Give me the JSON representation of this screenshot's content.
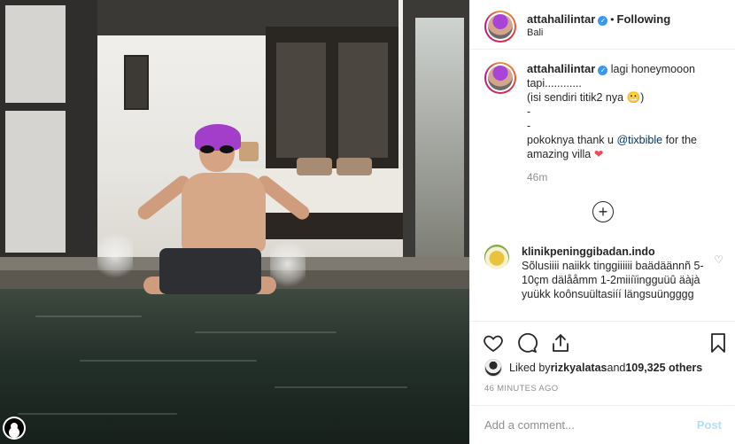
{
  "header": {
    "username": "attahalilintar",
    "follow_state": "Following",
    "location": "Bali"
  },
  "caption": {
    "username": "attahalilintar",
    "lines": [
      "lagi honeymooon",
      "tapi............",
      "(isi sendiri titik2 nya 😬)",
      "-",
      "-",
      "pokoknya thank u ",
      "for the",
      "amazing villa "
    ],
    "mention": "@tixbible",
    "heart": "❤",
    "time": "46m"
  },
  "comment": {
    "username": "klinikpeninggibadan.indo",
    "text": "Sõlusiiii naiikk tinggiiiiii baädäännñ 5-10çm dälååmm 1-2miiíïingguüû äàjà yuükk koônsuültasiíí längsuüngggg"
  },
  "likes": {
    "prefix": "Liked by ",
    "user": "rizkyalatas",
    "middle": " and ",
    "count": "109,325 others"
  },
  "timestamp": "46 MINUTES AGO",
  "add_comment": {
    "placeholder": "Add a comment...",
    "post_label": "Post"
  },
  "icons": {
    "verified": "verified-badge",
    "like": "heart-icon",
    "comment": "comment-icon",
    "share": "share-icon",
    "save": "bookmark-icon",
    "more": "plus-circle-icon"
  },
  "colors": {
    "link": "#003569",
    "verified": "#3897f0",
    "post_disabled": "#b2dffc",
    "muted": "#8e8e8e"
  }
}
